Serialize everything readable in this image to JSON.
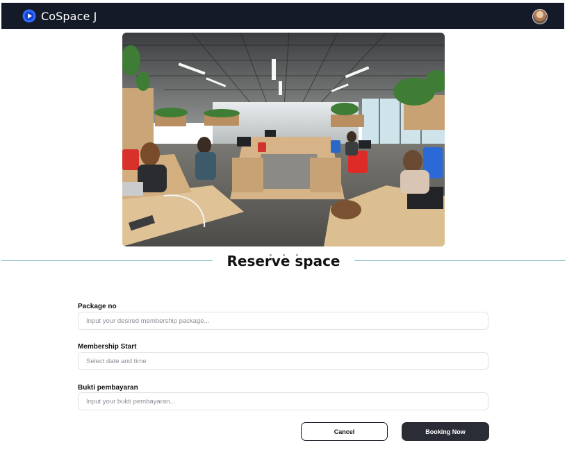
{
  "header": {
    "app_title": "CoSpace J",
    "logo_icon": "play-circle-icon",
    "avatar_icon": "user-avatar"
  },
  "hero": {
    "image": "coworking-office-photo",
    "carousel_dots": 3
  },
  "section": {
    "title": "Reserve space"
  },
  "form": {
    "package": {
      "label": "Package no",
      "placeholder": "Input your desired membership package...",
      "value": ""
    },
    "membership_start": {
      "label": "Membership Start",
      "placeholder": "Select date and time",
      "value": ""
    },
    "payment_proof": {
      "label": "Bukti pembayaran",
      "placeholder": "Input your bukti pembayaran...",
      "value": ""
    }
  },
  "actions": {
    "cancel_label": "Cancel",
    "booking_label": "Booking Now"
  },
  "colors": {
    "navbar": "#141a28",
    "logo_accent": "#2f6bff",
    "divider": "#7fb7c0",
    "primary_button": "#2a2d36"
  }
}
